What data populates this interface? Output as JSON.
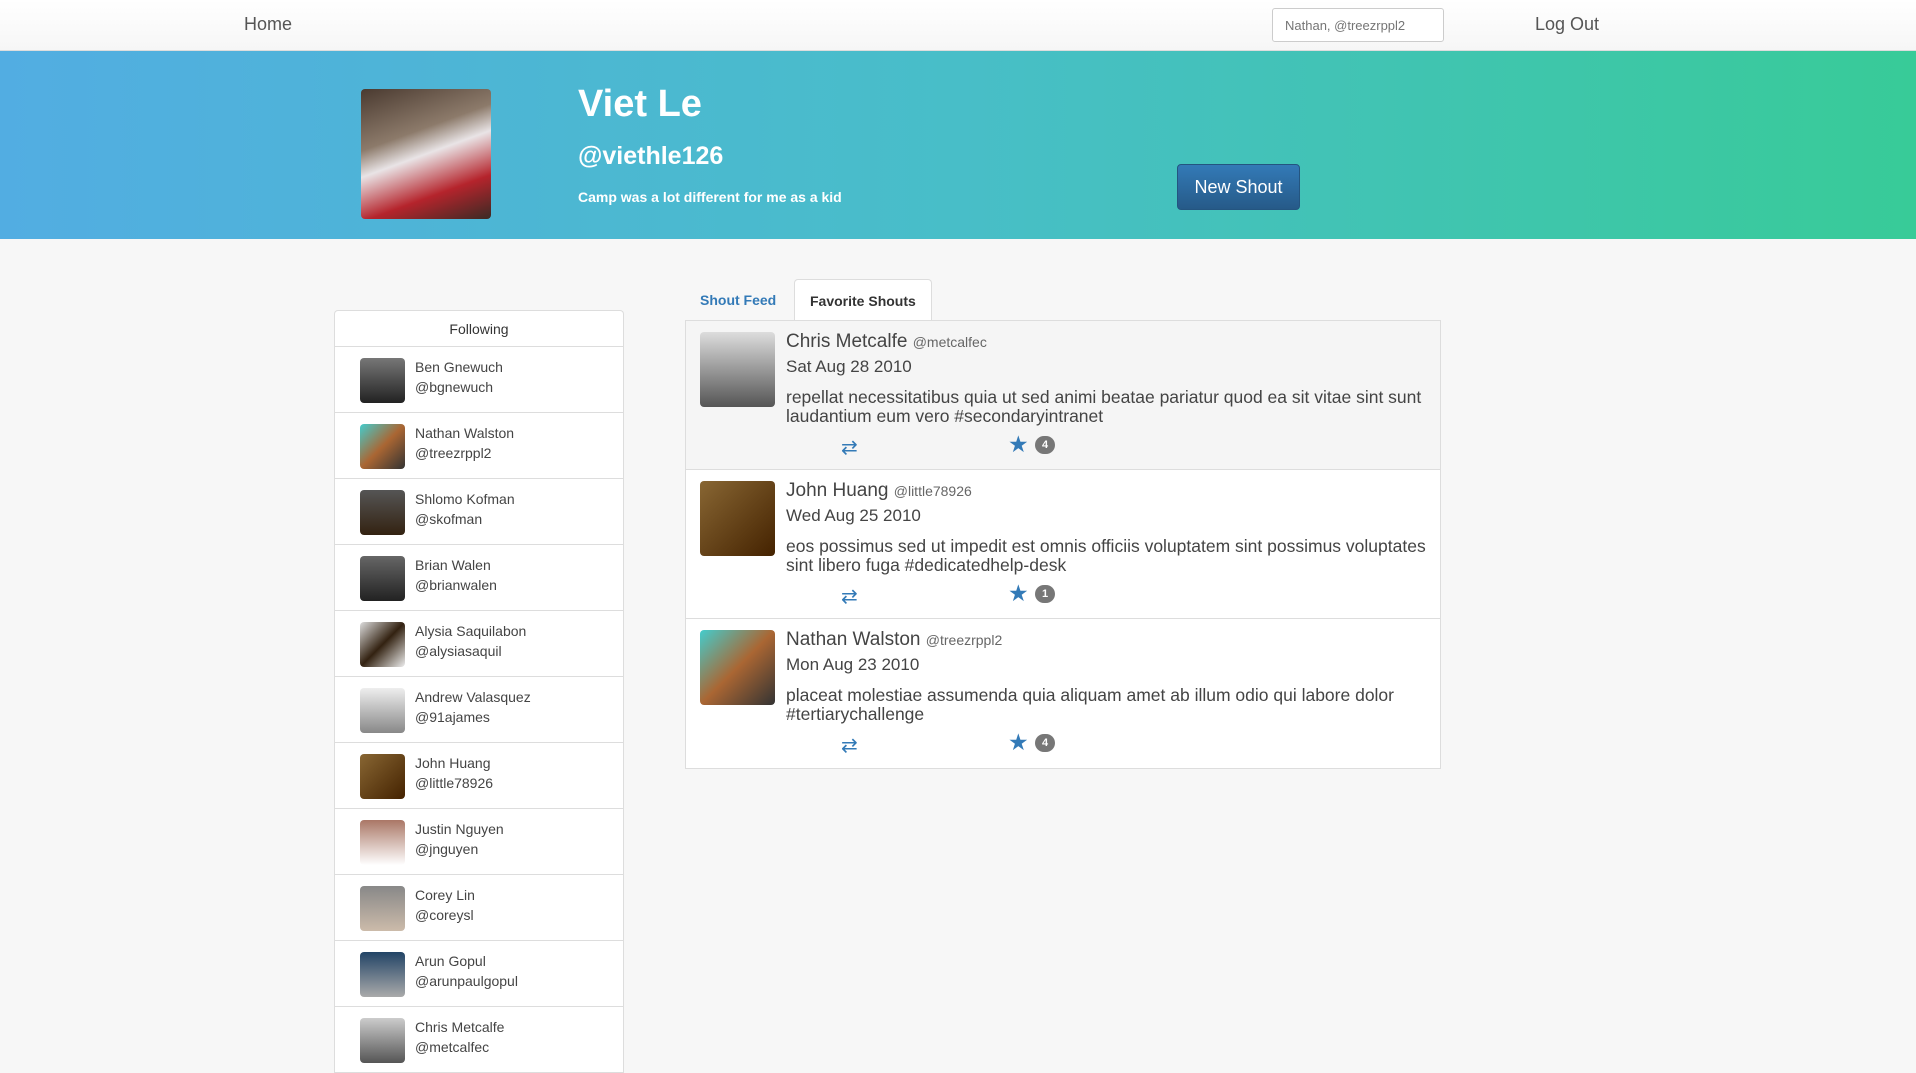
{
  "nav": {
    "home": "Home",
    "search_placeholder": "Nathan, @treezrppl2",
    "logout": "Log Out"
  },
  "profile": {
    "name": "Viet Le",
    "handle": "@viethle126",
    "bio": "Camp was a lot different for me as a kid",
    "new_shout": "New Shout"
  },
  "sidebar": {
    "title": "Following",
    "items": [
      {
        "name": "Ben Gnewuch",
        "handle": "@bgnewuch"
      },
      {
        "name": "Nathan Walston",
        "handle": "@treezrppl2"
      },
      {
        "name": "Shlomo Kofman",
        "handle": "@skofman"
      },
      {
        "name": "Brian Walen",
        "handle": "@brianwalen"
      },
      {
        "name": "Alysia Saquilabon",
        "handle": "@alysiasaquil"
      },
      {
        "name": "Andrew Valasquez",
        "handle": "@91ajames"
      },
      {
        "name": "John Huang",
        "handle": "@little78926"
      },
      {
        "name": "Justin Nguyen",
        "handle": "@jnguyen"
      },
      {
        "name": "Corey Lin",
        "handle": "@coreysl"
      },
      {
        "name": "Arun Gopul",
        "handle": "@arunpaulgopul"
      },
      {
        "name": "Chris Metcalfe",
        "handle": "@metcalfec"
      }
    ]
  },
  "tabs": [
    {
      "label": "Shout Feed"
    },
    {
      "label": "Favorite Shouts",
      "active": true
    }
  ],
  "shouts": [
    {
      "name": "Chris Metcalfe",
      "handle": "@metcalfec",
      "date": "Sat Aug 28 2010",
      "text": "repellat necessitatibus quia ut sed animi beatae pariatur quod ea sit vitae sint sunt laudantium eum vero #secondaryintranet",
      "favorites": "4"
    },
    {
      "name": "John Huang",
      "handle": "@little78926",
      "date": "Wed Aug 25 2010",
      "text": "eos possimus sed ut impedit est omnis officiis voluptatem sint possimus voluptates sint libero fuga #dedicatedhelp-desk",
      "favorites": "1"
    },
    {
      "name": "Nathan Walston",
      "handle": "@treezrppl2",
      "date": "Mon Aug 23 2010",
      "text": "placeat molestiae assumenda quia aliquam amet ab illum odio qui labore dolor #tertiarychallenge",
      "favorites": "4"
    }
  ],
  "colors": {
    "accent": "#337ab7",
    "gradient_start": "#52ade2",
    "gradient_end": "#38cb98"
  }
}
